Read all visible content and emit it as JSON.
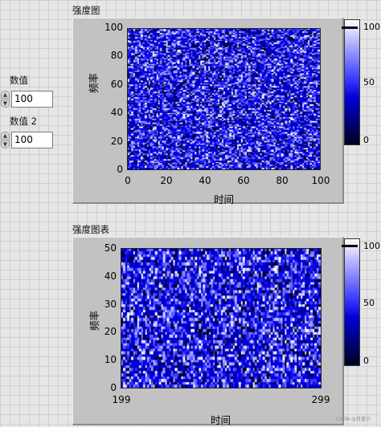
{
  "controls": [
    {
      "label": "数值",
      "value": "100"
    },
    {
      "label": "数值 2",
      "value": "100"
    }
  ],
  "graph1": {
    "title": "强度图",
    "xlabel": "时间",
    "ylabel": "频率",
    "xticks": [
      "0",
      "20",
      "40",
      "60",
      "80",
      "100"
    ],
    "yticks": [
      "100",
      "80",
      "60",
      "40",
      "20",
      "0"
    ],
    "scale_ticks": [
      "100",
      "50",
      "0"
    ]
  },
  "graph2": {
    "title": "强度图表",
    "xlabel": "时间",
    "ylabel": "频率",
    "xticks": [
      "199",
      "299"
    ],
    "yticks": [
      "50",
      "40",
      "30",
      "20",
      "10",
      "0"
    ],
    "scale_ticks": [
      "100",
      "50",
      "0"
    ]
  },
  "watermark": "CSDN @月蓝小",
  "colors": {
    "high": "#ffffff",
    "mid": "#3030ff",
    "low": "#000000"
  }
}
